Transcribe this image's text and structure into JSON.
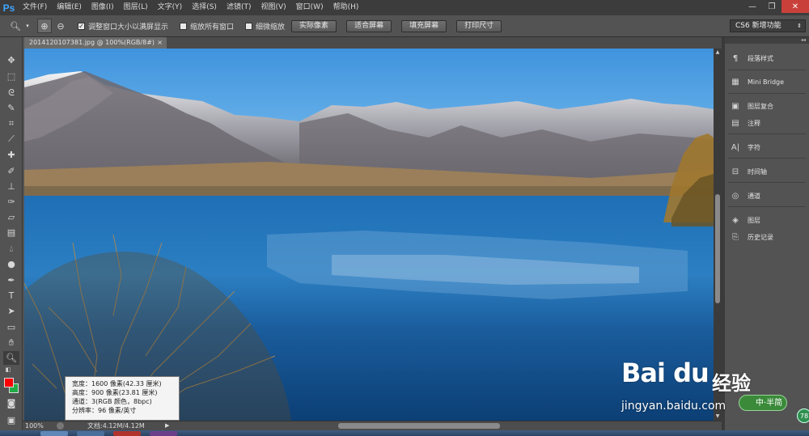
{
  "app": {
    "logo": "Ps",
    "menu": [
      "文件(F)",
      "编辑(E)",
      "图像(I)",
      "图层(L)",
      "文字(Y)",
      "选择(S)",
      "滤镜(T)",
      "视图(V)",
      "窗口(W)",
      "帮助(H)"
    ],
    "window_controls": {
      "minimize": "—",
      "restore": "❐",
      "close": "✕"
    }
  },
  "options": {
    "resize_windows": {
      "label": "调整窗口大小以满屏显示",
      "checked": true
    },
    "zoom_all": {
      "label": "缩放所有窗口",
      "checked": false
    },
    "scrubby_zoom": {
      "label": "细微缩放",
      "checked": false
    },
    "buttons": [
      "实际像素",
      "适合屏幕",
      "填充屏幕",
      "打印尺寸"
    ],
    "workspace": "CS6 新增功能"
  },
  "document": {
    "tab_title": "2014120107381.jpg @ 100%(RGB/8#)",
    "close": "×"
  },
  "status": {
    "zoom": "100%",
    "doc_size": "文档:4.12M/4.12M",
    "arrow": "▶"
  },
  "info_popup": {
    "width": "宽度：1600 像素(42.33 厘米)",
    "height": "高度：900 像素(23.81 厘米)",
    "channels": "通道：3(RGB 颜色，8bpc)",
    "resolution": "分辨率：96 像素/英寸"
  },
  "panels": [
    {
      "icon": "paragraph-styles-icon",
      "glyph": "¶",
      "label": "段落样式"
    },
    {
      "icon": "mini-bridge-icon",
      "glyph": "▦",
      "label": "Mini Bridge"
    },
    {
      "icon": "layer-comps-icon",
      "glyph": "▣",
      "label": "图层复合"
    },
    {
      "icon": "notes-icon",
      "glyph": "▤",
      "label": "注释"
    },
    {
      "icon": "character-icon",
      "glyph": "A|",
      "label": "字符"
    },
    {
      "icon": "timeline-icon",
      "glyph": "⊟",
      "label": "时间轴"
    },
    {
      "icon": "channels-icon",
      "glyph": "◎",
      "label": "通道"
    },
    {
      "icon": "layers-icon",
      "glyph": "◈",
      "label": "图层"
    },
    {
      "icon": "history-icon",
      "glyph": "⎘",
      "label": "历史记录"
    }
  ],
  "watermark": {
    "logo": "Bai du",
    "cn": "经验",
    "url": "jingyan.baidu.com",
    "badge": "中·半简",
    "badge_num": "78"
  },
  "colors": {
    "foreground": "#ff0000",
    "background": "#22aa44",
    "ps_blue": "#3fa7ff"
  }
}
